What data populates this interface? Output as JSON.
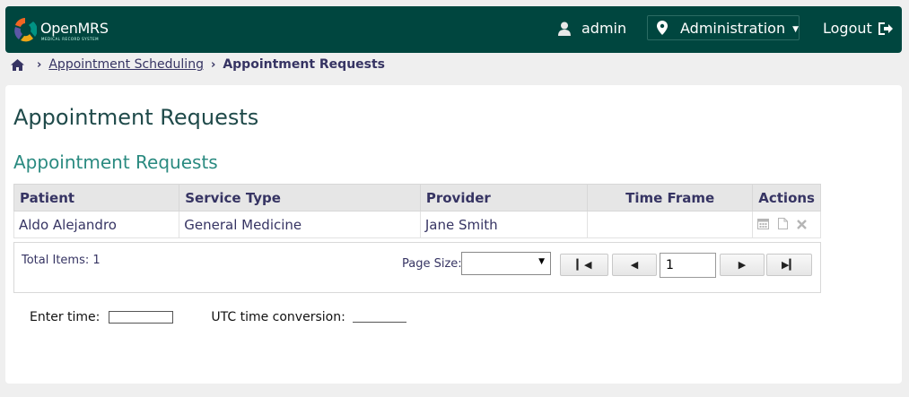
{
  "header": {
    "brand": "OpenMRS",
    "brand_tagline": "MEDICAL RECORD SYSTEM",
    "user": "admin",
    "location": "Administration",
    "logout": "Logout"
  },
  "breadcrumb": {
    "home_icon": "home-icon",
    "parent": "Appointment Scheduling",
    "current": "Appointment Requests"
  },
  "page": {
    "title": "Appointment Requests",
    "section_title": "Appointment Requests"
  },
  "table": {
    "columns": [
      "Patient",
      "Service Type",
      "Provider",
      "Time Frame",
      "Actions"
    ],
    "rows": [
      {
        "patient": "Aldo Alejandro",
        "service_type": "General Medicine",
        "provider": "Jane Smith",
        "time_frame": ""
      }
    ],
    "action_icons": [
      "calendar-icon",
      "file-icon",
      "close-icon"
    ]
  },
  "pagination": {
    "total_label": "Total Items: 1",
    "page_size_label": "Page Size:",
    "page_size_value": "",
    "page": "1"
  },
  "time": {
    "enter_label": "Enter time:",
    "utc_label": "UTC time conversion:"
  },
  "colors": {
    "header_bg": "#00463f",
    "accent": "#2a8a80"
  }
}
